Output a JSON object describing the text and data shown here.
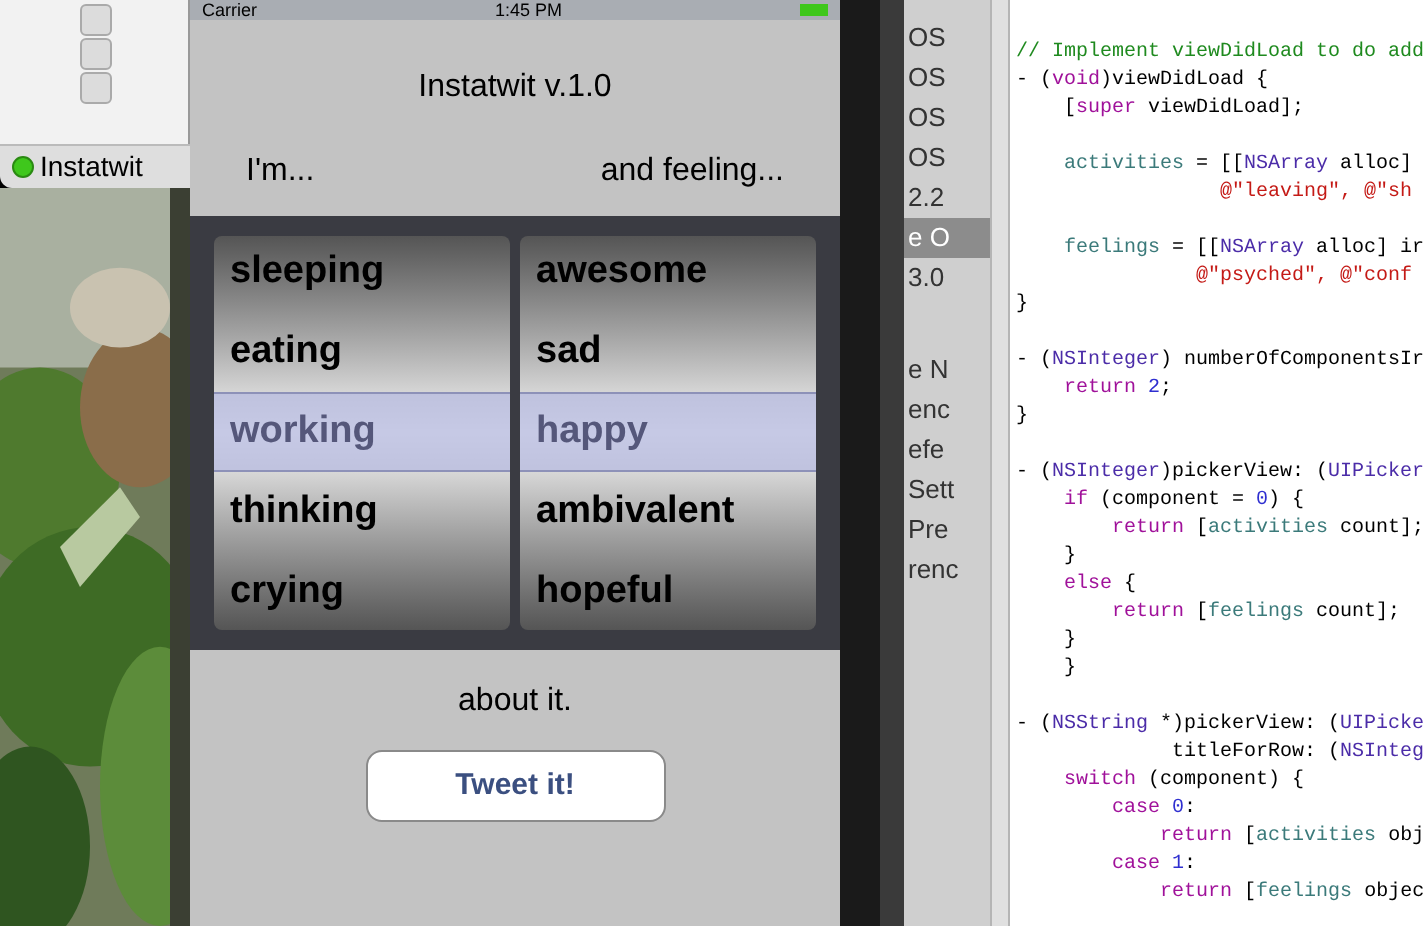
{
  "desktop": {
    "window_tab": {
      "title": "Instatwit"
    }
  },
  "simulator": {
    "status_bar": {
      "carrier": "Carrier",
      "time": "1:45 PM"
    },
    "title": "Instatwit v.1.0",
    "left_label": "I'm...",
    "right_label": "and feeling...",
    "picker": {
      "columns": [
        {
          "rows": [
            {
              "text": "sleeping",
              "selected": false
            },
            {
              "text": "eating",
              "selected": false
            },
            {
              "text": "working",
              "selected": true
            },
            {
              "text": "thinking",
              "selected": false
            },
            {
              "text": "crying",
              "selected": false
            }
          ]
        },
        {
          "rows": [
            {
              "text": "awesome",
              "selected": false
            },
            {
              "text": "sad",
              "selected": false
            },
            {
              "text": "happy",
              "selected": true
            },
            {
              "text": "ambivalent",
              "selected": false
            },
            {
              "text": "hopeful",
              "selected": false
            }
          ]
        }
      ]
    },
    "footer_label": "about it.",
    "button": "Tweet it!"
  },
  "xcode": {
    "sidebar": {
      "items": [
        {
          "text": "OS",
          "selected": false
        },
        {
          "text": "OS",
          "selected": false
        },
        {
          "text": "OS",
          "selected": false
        },
        {
          "text": "OS",
          "selected": false
        },
        {
          "text": "2.2",
          "selected": false
        },
        {
          "text": "e O",
          "selected": true
        },
        {
          "text": "3.0",
          "selected": false
        },
        {
          "text": "e N",
          "selected": false
        },
        {
          "text": "enc",
          "selected": false
        },
        {
          "text": "efe",
          "selected": false
        },
        {
          "text": "Sett",
          "selected": false
        },
        {
          "text": "Pre",
          "selected": false
        },
        {
          "text": "renc",
          "selected": false
        }
      ]
    },
    "code_lines": [
      {
        "kind": "code",
        "tokens": [
          {
            "text": "// Implement viewDidLoad to do add",
            "kind": "comment"
          }
        ]
      },
      {
        "kind": "code",
        "tokens": [
          {
            "text": "- (",
            "kind": "plain"
          },
          {
            "text": "void",
            "kind": "keyword"
          },
          {
            "text": ")viewDidLoad {",
            "kind": "plain"
          }
        ]
      },
      {
        "kind": "code",
        "tokens": [
          {
            "text": "    [",
            "kind": "plain"
          },
          {
            "text": "super",
            "kind": "keyword"
          },
          {
            "text": " viewDidLoad];",
            "kind": "plain"
          }
        ]
      },
      {
        "kind": "blank"
      },
      {
        "kind": "code",
        "tokens": [
          {
            "text": "    activities",
            "kind": "ivar"
          },
          {
            "text": " = [[",
            "kind": "plain"
          },
          {
            "text": "NSArray",
            "kind": "type"
          },
          {
            "text": " alloc]",
            "kind": "plain"
          }
        ]
      },
      {
        "kind": "code",
        "tokens": [
          {
            "text": "                 @\"leaving\", @\"sh",
            "kind": "string"
          }
        ]
      },
      {
        "kind": "blank"
      },
      {
        "kind": "code",
        "tokens": [
          {
            "text": "    feelings",
            "kind": "ivar"
          },
          {
            "text": " = [[",
            "kind": "plain"
          },
          {
            "text": "NSArray",
            "kind": "type"
          },
          {
            "text": " alloc] ir",
            "kind": "plain"
          }
        ]
      },
      {
        "kind": "code",
        "tokens": [
          {
            "text": "               @\"psyched\", @\"conf",
            "kind": "string"
          }
        ]
      },
      {
        "kind": "code",
        "tokens": [
          {
            "text": "}",
            "kind": "plain"
          }
        ]
      },
      {
        "kind": "blank"
      },
      {
        "kind": "code",
        "tokens": [
          {
            "text": "- (",
            "kind": "plain"
          },
          {
            "text": "NSInteger",
            "kind": "type"
          },
          {
            "text": ") numberOfComponentsIr",
            "kind": "plain"
          }
        ]
      },
      {
        "kind": "code",
        "tokens": [
          {
            "text": "    return",
            "kind": "keyword"
          },
          {
            "text": " 2",
            "kind": "number"
          },
          {
            "text": ";",
            "kind": "plain"
          }
        ]
      },
      {
        "kind": "code",
        "tokens": [
          {
            "text": "}",
            "kind": "plain"
          }
        ]
      },
      {
        "kind": "blank"
      },
      {
        "kind": "code",
        "tokens": [
          {
            "text": "- (",
            "kind": "plain"
          },
          {
            "text": "NSInteger",
            "kind": "type"
          },
          {
            "text": ")pickerView: (",
            "kind": "plain"
          },
          {
            "text": "UIPicker",
            "kind": "type"
          }
        ]
      },
      {
        "kind": "code",
        "tokens": [
          {
            "text": "    if",
            "kind": "keyword"
          },
          {
            "text": " (component = ",
            "kind": "plain"
          },
          {
            "text": "0",
            "kind": "number"
          },
          {
            "text": ") {",
            "kind": "plain"
          }
        ]
      },
      {
        "kind": "code",
        "tokens": [
          {
            "text": "        return",
            "kind": "keyword"
          },
          {
            "text": " [",
            "kind": "plain"
          },
          {
            "text": "activities",
            "kind": "ivar"
          },
          {
            "text": " count];",
            "kind": "plain"
          }
        ]
      },
      {
        "kind": "code",
        "tokens": [
          {
            "text": "    }",
            "kind": "plain"
          }
        ]
      },
      {
        "kind": "code",
        "tokens": [
          {
            "text": "    else",
            "kind": "keyword"
          },
          {
            "text": " {",
            "kind": "plain"
          }
        ]
      },
      {
        "kind": "code",
        "tokens": [
          {
            "text": "        return",
            "kind": "keyword"
          },
          {
            "text": " [",
            "kind": "plain"
          },
          {
            "text": "feelings",
            "kind": "ivar"
          },
          {
            "text": " count];",
            "kind": "plain"
          }
        ]
      },
      {
        "kind": "code",
        "tokens": [
          {
            "text": "    }",
            "kind": "plain"
          }
        ]
      },
      {
        "kind": "code",
        "tokens": [
          {
            "text": "    }",
            "kind": "plain"
          }
        ]
      },
      {
        "kind": "blank"
      },
      {
        "kind": "code",
        "tokens": [
          {
            "text": "- (",
            "kind": "plain"
          },
          {
            "text": "NSString",
            "kind": "type"
          },
          {
            "text": " *)pickerView: (",
            "kind": "plain"
          },
          {
            "text": "UIPicke",
            "kind": "type"
          }
        ]
      },
      {
        "kind": "code",
        "tokens": [
          {
            "text": "             titleForRow: (",
            "kind": "plain"
          },
          {
            "text": "NSInteg",
            "kind": "type"
          }
        ]
      },
      {
        "kind": "code",
        "tokens": [
          {
            "text": "    switch",
            "kind": "keyword"
          },
          {
            "text": " (component) {",
            "kind": "plain"
          }
        ]
      },
      {
        "kind": "code",
        "tokens": [
          {
            "text": "        case",
            "kind": "keyword"
          },
          {
            "text": " 0",
            "kind": "number"
          },
          {
            "text": ":",
            "kind": "plain"
          }
        ]
      },
      {
        "kind": "code",
        "tokens": [
          {
            "text": "            return",
            "kind": "keyword"
          },
          {
            "text": " [",
            "kind": "plain"
          },
          {
            "text": "activities",
            "kind": "ivar"
          },
          {
            "text": " obj",
            "kind": "plain"
          }
        ]
      },
      {
        "kind": "code",
        "tokens": [
          {
            "text": "        case",
            "kind": "keyword"
          },
          {
            "text": " 1",
            "kind": "number"
          },
          {
            "text": ":",
            "kind": "plain"
          }
        ]
      },
      {
        "kind": "code",
        "tokens": [
          {
            "text": "            return",
            "kind": "keyword"
          },
          {
            "text": " [",
            "kind": "plain"
          },
          {
            "text": "feelings",
            "kind": "ivar"
          },
          {
            "text": " objec",
            "kind": "plain"
          }
        ]
      }
    ]
  }
}
